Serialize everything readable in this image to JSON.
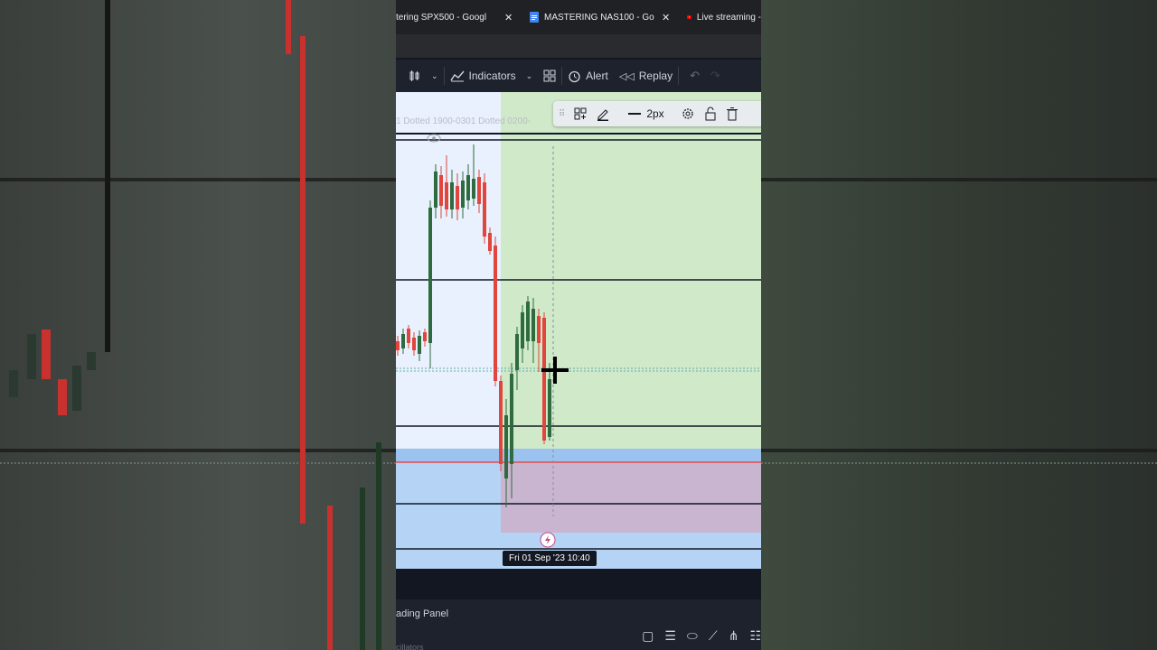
{
  "browser": {
    "tabs": [
      {
        "label": "tering SPX500 - Googl",
        "icon": "docs-icon"
      },
      {
        "label": "MASTERING NAS100 - Goo",
        "icon": "docs-icon"
      },
      {
        "label": "Live streaming -",
        "icon": "youtube-icon"
      }
    ],
    "close_glyph": "✕"
  },
  "toolbar": {
    "indicators_label": "Indicators",
    "alert_label": "Alert",
    "replay_label": "Replay",
    "bar_style_label": "ᛖ0"
  },
  "drawing_toolbar": {
    "line_width_label": "2px"
  },
  "chart": {
    "legend_text": "1 Dotted 1900-0301 Dotted 0200-",
    "crosshair_date_label": "Fri 01 Sep '23   10:40",
    "colors": {
      "bull": "#2e6b3e",
      "bear": "#e2453c",
      "zone_green": "#cfe9c9",
      "zone_blue": "#b5d3f5",
      "zone_purple": "#c9b5cf",
      "level_red": "#e34b4b"
    }
  },
  "bottom_panel": {
    "trading_panel_label": "ading Panel",
    "oscillators_label": "cillators"
  }
}
